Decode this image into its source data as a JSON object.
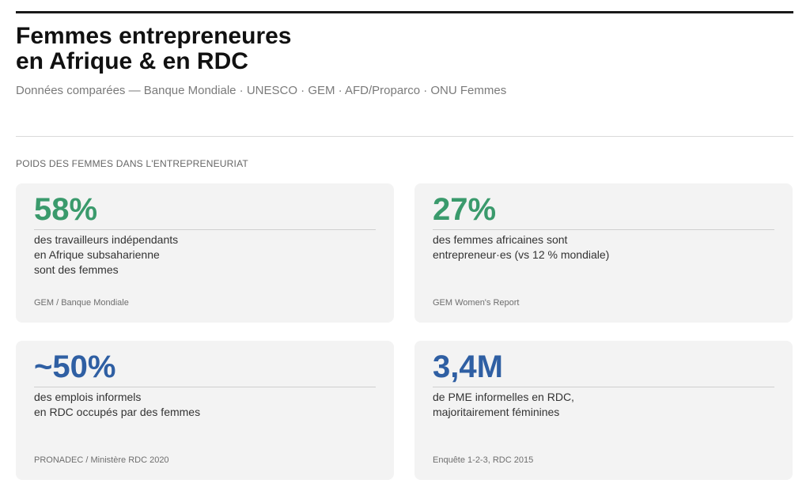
{
  "header": {
    "title_line1": "Femmes entrepreneures",
    "title_line2": "en Afrique & en RDC",
    "subtitle": "Données comparées — Banque Mondiale · UNESCO · GEM · AFD/Proparco · ONU Femmes"
  },
  "section": {
    "label": "POIDS DES FEMMES DANS L'ENTREPRENEURIAT"
  },
  "colors": {
    "green_value": "#3a9a6c",
    "blue_value": "#2f5fa3"
  },
  "cards": [
    {
      "value": "58%",
      "value_color": "green",
      "desc_lines": [
        "des travailleurs indépendants",
        "en Afrique subsaharienne",
        "sont des femmes"
      ],
      "source": "GEM / Banque Mondiale"
    },
    {
      "value": "27%",
      "value_color": "green",
      "desc_lines": [
        "des femmes africaines sont",
        "entrepreneur·es (vs 12 % mondiale)",
        ""
      ],
      "source": "GEM Women's Report"
    },
    {
      "value": "~50%",
      "value_color": "blue",
      "desc_lines": [
        "des emplois informels",
        "en RDC occupés par des femmes",
        ""
      ],
      "source": "PRONADEC / Ministère RDC 2020"
    },
    {
      "value": "3,4M",
      "value_color": "blue",
      "desc_lines": [
        "de PME informelles en RDC,",
        "majoritairement féminines",
        ""
      ],
      "source": "Enquête 1-2-3, RDC 2015"
    }
  ]
}
